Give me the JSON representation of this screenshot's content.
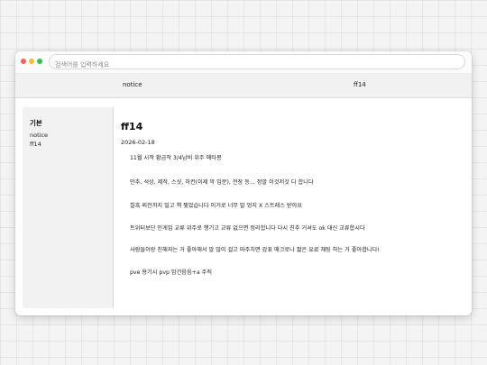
{
  "browser": {
    "search_placeholder": "검색어를 입력하세요"
  },
  "tabs": [
    {
      "label": "notice"
    },
    {
      "label": "ff14"
    }
  ],
  "sidebar": {
    "heading": "기본",
    "items": [
      {
        "label": "notice"
      },
      {
        "label": "ff14"
      }
    ]
  },
  "post": {
    "title": "ff14",
    "date": "2026-02-18",
    "lines": [
      "11월 시작 황금작 3/4남비 위주 메타몽",
      "만추, 석상, 제작, 스샷, 하컨(이제 막 입문), 전장 등... 정말 이것저것 다 합니다",
      "칠흑 외전까지 밀고 책 찢었습니다 이거로 너무 말 엉지 X 스트레스 받아요",
      "트위터보단 인게임 교류 위주로 행기고 교류 없으면 정리합니다 다시 친추 거셔도 ok 대신 교류합시다",
      "사람들이랑 친해지는 거 좋아해서 말 많이 걸고 마주치면 감표 매크로나 짧은 유료 채팅 하는 거 좋아합니다!",
      "pve 용기시 pvp 암건음음+a 주직"
    ]
  },
  "colors": {
    "close": "#ff5f57",
    "minimize": "#febc2e",
    "maximize": "#28c840",
    "sidebar_bg": "#f2f2f2",
    "tabbar_bg": "#f1f1f1"
  }
}
